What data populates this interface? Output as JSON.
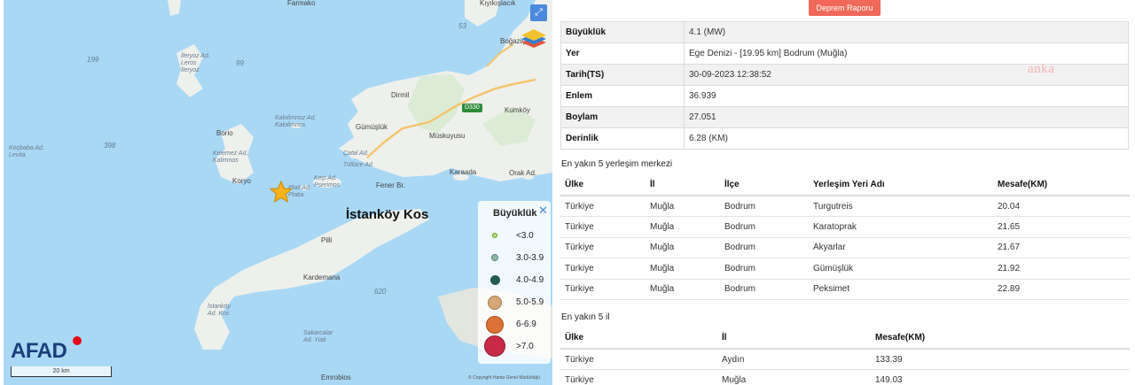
{
  "map": {
    "labels": {
      "farmako": "Farmako",
      "kiyikislacik": "Kıyıkışlacık",
      "depth_53": "53",
      "depth_199": "199",
      "depth_99": "99",
      "ileryoz": "İleryoz Ad. Leros İleryoz",
      "bogazici": "Boğaziçi",
      "dirmil": "Dirmil",
      "kumkoy": "Kumköy",
      "kalolimnoz": "Kalolimnoz Ad. Kalolimnos",
      "gumusluk": "Gümüşlük",
      "muskuyusu": "Müskuyusu",
      "borio": "Borio",
      "depth_398": "398",
      "kocbaba": "Koçbaba Ad. Levita",
      "kelemez": "Kelemez Ad. Kalimnos",
      "catal": "Çatal Ad.",
      "tulluce": "Tüllüce Ad.",
      "karaada": "Karaada",
      "orak": "Orak Ad.",
      "koryo": "Koryo",
      "plati": "Plati Ad. Platia",
      "keci": "Keçi Ad. Pserimos",
      "fener": "Fener Br.",
      "istankoy": "İstanköy Kos",
      "pilli": "Pilli",
      "kardemana": "Kardemana",
      "depth_620": "620",
      "istankoy_ad": "İstanköy Ad. Kos",
      "sakarcalar": "Sakarcalar Ad. Yiali",
      "emrobios": "Emrobios"
    },
    "road_badge": "D330",
    "brand": "AFAD",
    "scale_label": "20 km",
    "copyright": "© Copyright Harita Genel Müdürlüğü",
    "legend": {
      "title": "Büyüklük",
      "items": [
        {
          "label": "<3.0",
          "color": "#b7e07a"
        },
        {
          "label": "3.0-3.9",
          "color": "#8fb8a8"
        },
        {
          "label": "4.0-4.9",
          "color": "#245e4f"
        },
        {
          "label": "5.0-5.9",
          "color": "#d5a878"
        },
        {
          "label": "6-6.9",
          "color": "#dc7235"
        },
        {
          "label": ">7.0",
          "color": "#c82a45"
        }
      ]
    }
  },
  "report_button": "Deprem Raporu",
  "watermark": "anka",
  "info": [
    {
      "key": "Büyüklük",
      "value": "4.1 (MW)"
    },
    {
      "key": "Yer",
      "value": "Ege Denizi - [19.95 km] Bodrum (Muğla)"
    },
    {
      "key": "Tarih(TS)",
      "value": "30-09-2023 12:38:52"
    },
    {
      "key": "Enlem",
      "value": "36.939"
    },
    {
      "key": "Boylam",
      "value": "27.051"
    },
    {
      "key": "Derinlik",
      "value": "6.28 (KM)"
    }
  ],
  "settlements": {
    "title": "En yakın 5 yerleşim merkezi",
    "headers": [
      "Ülke",
      "İl",
      "İlçe",
      "Yerleşim Yeri Adı",
      "Mesafe(KM)"
    ],
    "rows": [
      [
        "Türkiye",
        "Muğla",
        "Bodrum",
        "Turgutreis",
        "20.04"
      ],
      [
        "Türkiye",
        "Muğla",
        "Bodrum",
        "Karatoprak",
        "21.65"
      ],
      [
        "Türkiye",
        "Muğla",
        "Bodrum",
        "Akyarlar",
        "21.67"
      ],
      [
        "Türkiye",
        "Muğla",
        "Bodrum",
        "Gümüşlük",
        "21.92"
      ],
      [
        "Türkiye",
        "Muğla",
        "Bodrum",
        "Peksimet",
        "22.89"
      ]
    ]
  },
  "provinces": {
    "title": "En yakın 5 il",
    "headers": [
      "Ülke",
      "İl",
      "Mesafe(KM)"
    ],
    "rows": [
      [
        "Türkiye",
        "Aydın",
        "133.39"
      ],
      [
        "Türkiye",
        "Muğla",
        "149.03"
      ]
    ]
  }
}
